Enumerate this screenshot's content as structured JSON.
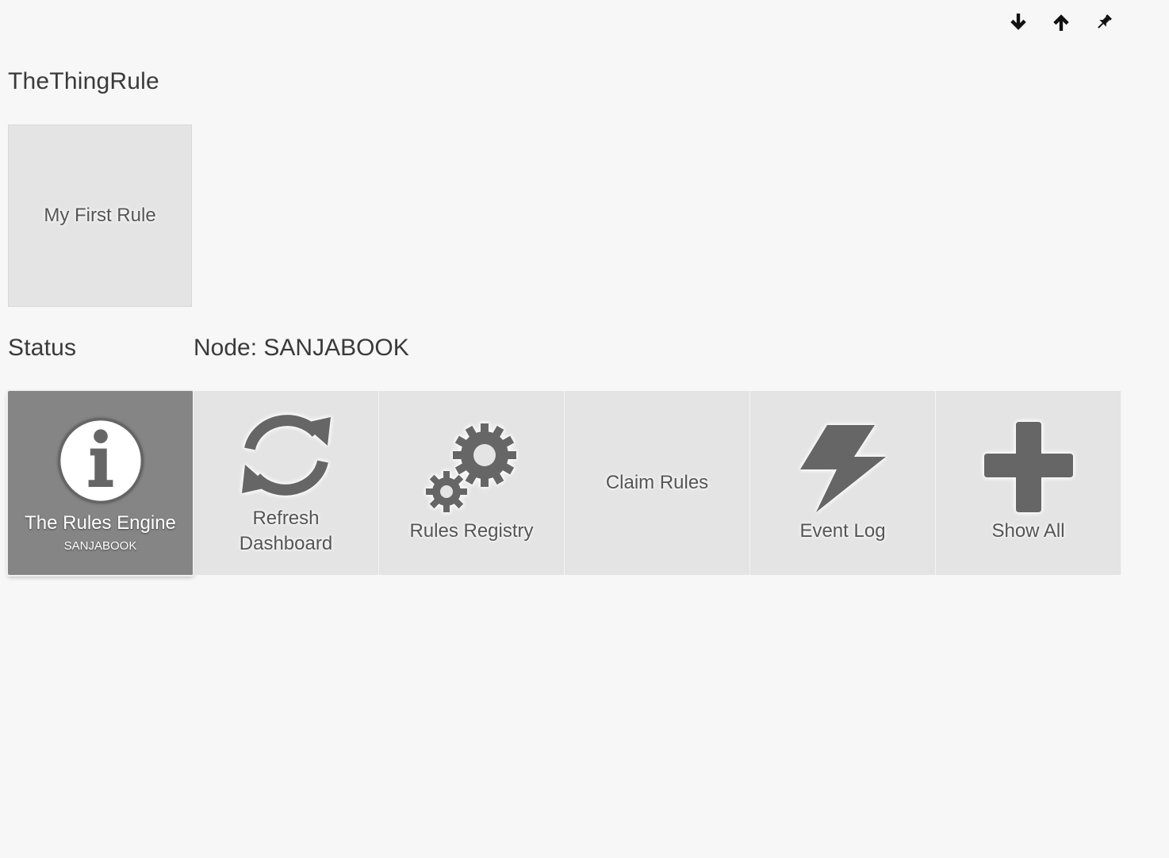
{
  "toolbar": {
    "icons": [
      "arrow-down-icon",
      "arrow-up-icon",
      "pin-icon"
    ]
  },
  "header": {
    "title": "TheThingRule"
  },
  "rules": [
    {
      "label": "My First Rule"
    }
  ],
  "status": {
    "title": "Status",
    "node": "Node: SANJABOOK"
  },
  "actions": [
    {
      "label": "The Rules Engine",
      "sub": "SANJABOOK",
      "icon": "info-icon",
      "active": true
    },
    {
      "label": "Refresh Dashboard",
      "icon": "refresh-icon"
    },
    {
      "label": "Rules Registry",
      "icon": "gears-icon"
    },
    {
      "label": "Claim Rules"
    },
    {
      "label": "Event Log",
      "icon": "lightning-icon"
    },
    {
      "label": "Show All",
      "icon": "plus-icon"
    }
  ],
  "colors": {
    "background": "#f7f7f7",
    "tile": "#e4e4e4",
    "tile_active": "#858585",
    "icon": "#666666"
  }
}
